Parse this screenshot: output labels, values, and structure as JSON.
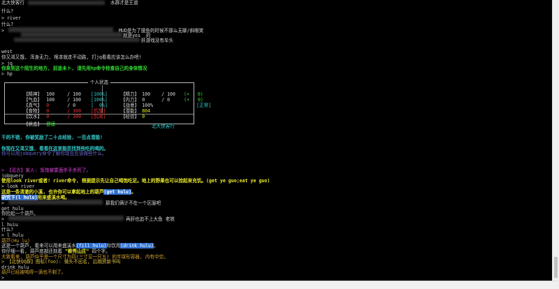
{
  "lines": {
    "l0": "北大侠客行",
    "l0b": "水群才是王道",
    "l1": "什么?",
    "l2": "> river",
    "l3": "什么?",
    "l4": ">",
    "l4b": "MUD是为了摸鱼的时候不那么无聊/斜眼笑",
    "l5b": "就是yes  的",
    "l6b": "肝游戏没有牟头",
    "l7": "west",
    "l8": "你又渴又饿, 浑身无力, 根本就走不动路, 打jq看看应该怎么办吧!",
    "l9": "> jq",
    "l10": "你来到这个陌生的地方, 前途未卜, 请先用hp命令检查自己的身体情况",
    "l11": "> hp",
    "l12": "干的不错, 你被奖励了二十点经验, 一百点潜能!",
    "l13": "你现在又渴又饿, 看看在这里能否找到些吃的喝的。",
    "l14": "你可以用jobquery命令了解你现在应该做些什么。",
    "l15": "> 【谣言】某人: 饭饱被霍面杀手杀死了。",
    "l16": "jobquery",
    "l17": "使用look river或者! river命令, 根据提示先让自己喝饱吃足。地上的野果也可以捡起来充饥。(get ye guo;eat ye guo)",
    "l18": "> look river",
    "l19a": "这是一条清澈的小溪, 也许你可以拿起地上的葫芦",
    "l19h": "(get hulu)",
    "l19b": "。",
    "l20a": "",
    "l20h": "研究下(l hulu)",
    "l20b": "用来盛溪水喝。",
    "l21": ">",
    "l21b": "那我们俩计不在一个区服吧",
    "l22": "get hulu",
    "l23": "你捡起一个葫芦。",
    "l24": ">",
    "l24b": "再肝也追不上大鱼 老铁",
    "l25": "l huiu",
    "l26": "什么?",
    "l27": "> l hulu",
    "l28": "葫芦(Hu lu)",
    "l29a": "这是一个葫芦, 看来可以用来盛溪水",
    "l29h": "(fill hulu)",
    "l29c": "和饮用",
    "l29h2": "(drink hulu)",
    "l29d": "。",
    "l30a": "你仔细一看, 葫芦底部还刻着 ",
    "l30q": "\"柳秀山庄\"",
    "l30b": " 四个字。",
    "l31": "大致看来, 葫芦似乎是一个尺寸为四(三寸见一尺五) 的半球形容器, 内有中空。",
    "l32": "> 【北侠QQ群】图标(foo): 做头不出名, 后期资新书叫",
    "l33": "drink hulu",
    "l34": "葫芦已经被喝得一滴也不剩了。",
    "l35": ">"
  },
  "status": {
    "title": "个人状态",
    "left": [
      {
        "label": "【精神】",
        "cur": "100",
        "max": "/ 100",
        "pct": "[100%]"
      },
      {
        "label": "【气血】",
        "cur": "100",
        "max": "/ 100",
        "pct": "[100%]"
      },
      {
        "label": "【真气】",
        "cur": "0",
        "max": "/ 0",
        "pct": "[  0%]"
      },
      {
        "label": "【食物】",
        "cur": "0",
        "max": "/ 300",
        "pct": "[饥饿]"
      },
      {
        "label": "【饮水】",
        "cur": "0",
        "max": "/ 300",
        "pct": "[饥渴]"
      }
    ],
    "right": [
      {
        "label": "【精力】",
        "cur": "100",
        "max": "/ 100",
        "pct": "(+   0)"
      },
      {
        "label": "【内力】",
        "cur": "0",
        "max": "/ 0",
        "pct": "(+   0)"
      },
      {
        "label": "【战意】",
        "cur": "100%",
        "max": "",
        "pct": "[正常]"
      },
      {
        "label": "【潜能】",
        "cur": "804",
        "max": "",
        "pct": ""
      },
      {
        "label": "【经验】",
        "cur": "0",
        "max": "",
        "pct": ""
      }
    ],
    "state_label": "【状态】",
    "state_value": "健康",
    "footer": "北大侠客行"
  },
  "colors": {
    "background": "#000000",
    "green": "#33dd33",
    "yellow": "#eaea2a",
    "cyan": "#33cccc",
    "red": "#ee3333",
    "magenta": "#dd44dd",
    "highlight": "#2d6fd0"
  }
}
